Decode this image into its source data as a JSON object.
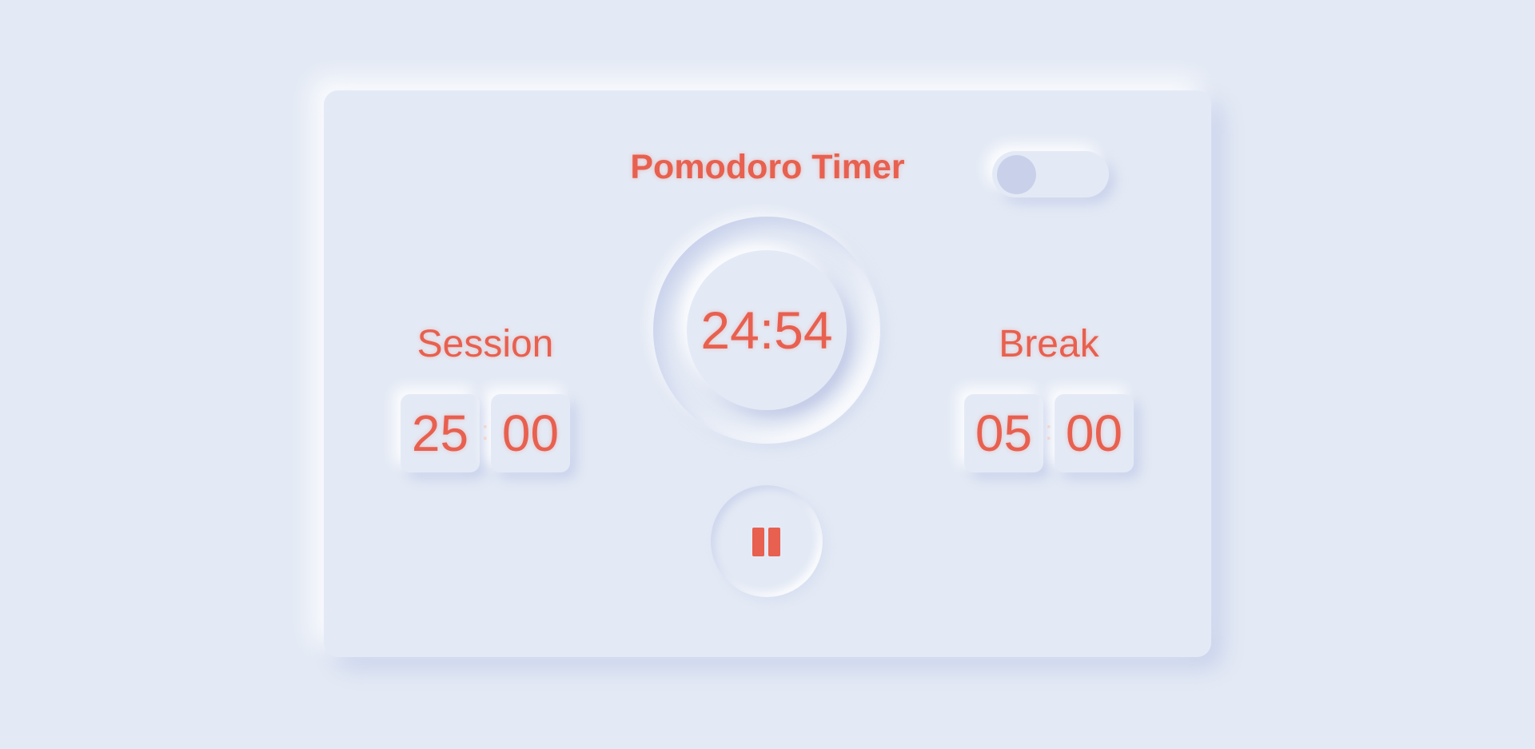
{
  "app": {
    "title": "Pomodoro Timer",
    "accent_color": "#e8604f",
    "background_color": "#e4eaf5",
    "theme_toggle": {
      "state": "off"
    }
  },
  "timer": {
    "display": "24:54",
    "state": "running",
    "control_icon": "pause-icon"
  },
  "session": {
    "label": "Session",
    "minutes": "25",
    "separator": ":",
    "seconds": "00"
  },
  "break": {
    "label": "Break",
    "minutes": "05",
    "separator": ":",
    "seconds": "00"
  }
}
